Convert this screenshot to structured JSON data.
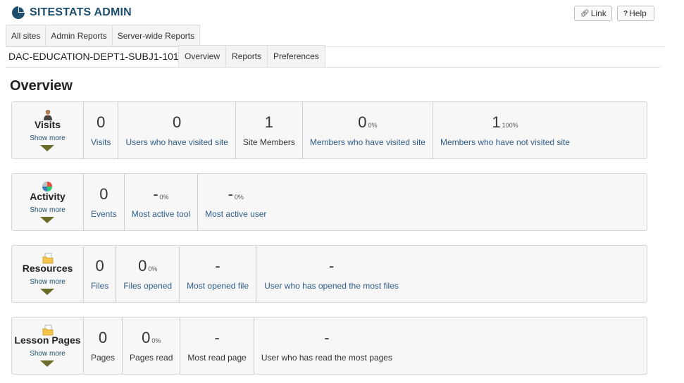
{
  "app": {
    "title": "SITESTATS ADMIN"
  },
  "top_buttons": {
    "link": "Link",
    "help": "Help"
  },
  "admin_tabs": [
    "All sites",
    "Admin Reports",
    "Server-wide Reports"
  ],
  "site": {
    "name": "DAC-EDUCATION-DEPT1-SUBJ1-101"
  },
  "site_tabs": [
    "Overview",
    "Reports",
    "Preferences"
  ],
  "page_heading": "Overview",
  "show_more_label": "Show more",
  "panels": [
    {
      "title": "Visits",
      "icon": "visits-person-icon",
      "stats": [
        {
          "value": "0",
          "pct": "",
          "label": "Visits",
          "link": true
        },
        {
          "value": "0",
          "pct": "",
          "label": "Users who have visited site",
          "link": true
        },
        {
          "value": "1",
          "pct": "",
          "label": "Site Members",
          "link": false
        },
        {
          "value": "0",
          "pct": "0%",
          "label": "Members who have visited site",
          "link": true
        },
        {
          "value": "1",
          "pct": "100%",
          "label": "Members who have not visited site",
          "link": true
        }
      ]
    },
    {
      "title": "Activity",
      "icon": "activity-chart-icon",
      "stats": [
        {
          "value": "0",
          "pct": "",
          "label": "Events",
          "link": true
        },
        {
          "value": "-",
          "pct": "0%",
          "label": "Most active tool",
          "link": true
        },
        {
          "value": "-",
          "pct": "0%",
          "label": "Most active user",
          "link": true
        }
      ]
    },
    {
      "title": "Resources",
      "icon": "resources-folder-icon",
      "stats": [
        {
          "value": "0",
          "pct": "",
          "label": "Files",
          "link": true
        },
        {
          "value": "0",
          "pct": "0%",
          "label": "Files opened",
          "link": true
        },
        {
          "value": "-",
          "pct": "",
          "label": "Most opened file",
          "link": true
        },
        {
          "value": "-",
          "pct": "",
          "label": "User who has opened the most files",
          "link": true
        }
      ]
    },
    {
      "title": "Lesson Pages",
      "icon": "lesson-pages-folder-icon",
      "stats": [
        {
          "value": "0",
          "pct": "",
          "label": "Pages",
          "link": false
        },
        {
          "value": "0",
          "pct": "0%",
          "label": "Pages read",
          "link": false
        },
        {
          "value": "-",
          "pct": "",
          "label": "Most read page",
          "link": false
        },
        {
          "value": "-",
          "pct": "",
          "label": "User who has read the most pages",
          "link": false
        }
      ]
    }
  ]
}
